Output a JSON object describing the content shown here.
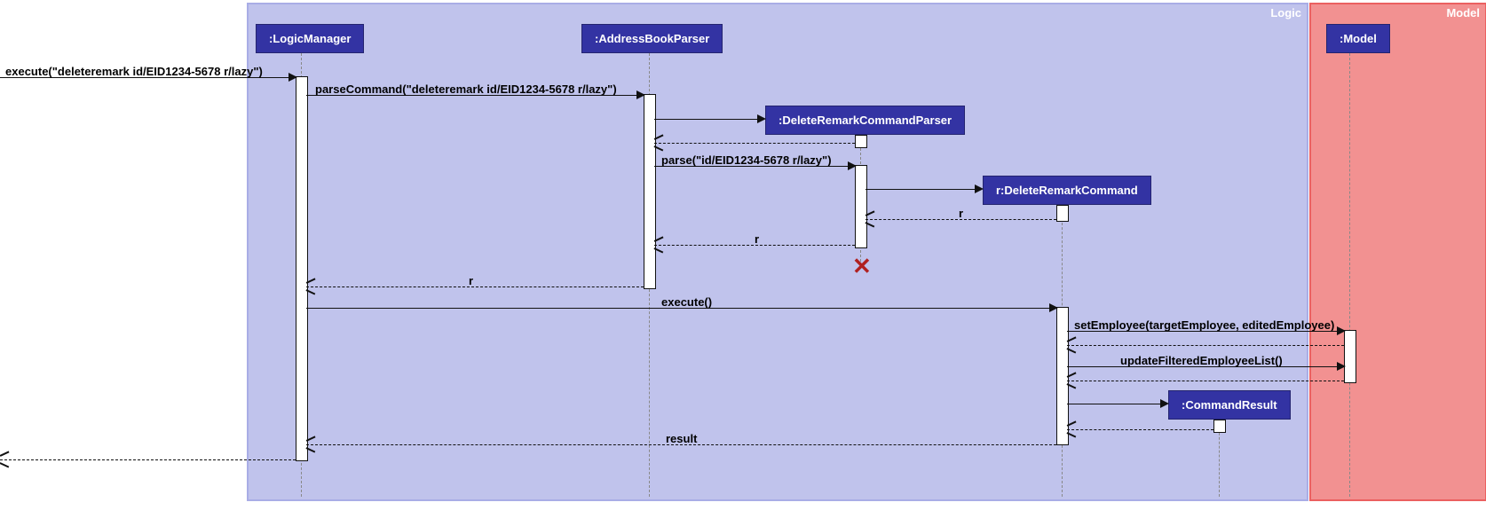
{
  "boxes": {
    "logic": "Logic",
    "model": "Model"
  },
  "lifelines": {
    "logicManager": ":LogicManager",
    "addressBookParser": ":AddressBookParser",
    "deleteRemarkCommandParser": ":DeleteRemarkCommandParser",
    "deleteRemarkCommand": "r:DeleteRemarkCommand",
    "commandResult": ":CommandResult",
    "model": ":Model"
  },
  "messages": {
    "execute1": "execute(\"deleteremark id/EID1234-5678 r/lazy\")",
    "parseCommand": "parseCommand(\"deleteremark id/EID1234-5678 r/lazy\")",
    "parse": "parse(\"id/EID1234-5678 r/lazy\")",
    "r1": "r",
    "r2": "r",
    "r3": "r",
    "execute2": "execute()",
    "setEmployee": "setEmployee(targetEmployee, editedEmployee)",
    "updateFiltered": "updateFilteredEmployeeList()",
    "result": "result"
  },
  "chart_data": {
    "type": "sequence_diagram",
    "boxes": [
      {
        "name": "Logic",
        "color": "#c0c3ec",
        "participants": [
          "LogicManager",
          "AddressBookParser",
          "DeleteRemarkCommandParser",
          "r:DeleteRemarkCommand",
          "CommandResult"
        ]
      },
      {
        "name": "Model",
        "color": "#f29191",
        "participants": [
          "Model"
        ]
      }
    ],
    "participants": [
      "(external)",
      "LogicManager",
      "AddressBookParser",
      "DeleteRemarkCommandParser",
      "r:DeleteRemarkCommand",
      "CommandResult",
      "Model"
    ],
    "messages": [
      {
        "from": "(external)",
        "to": "LogicManager",
        "label": "execute(\"deleteremark id/EID1234-5678 r/lazy\")",
        "type": "call"
      },
      {
        "from": "LogicManager",
        "to": "AddressBookParser",
        "label": "parseCommand(\"deleteremark id/EID1234-5678 r/lazy\")",
        "type": "call"
      },
      {
        "from": "AddressBookParser",
        "to": "DeleteRemarkCommandParser",
        "label": "",
        "type": "create"
      },
      {
        "from": "DeleteRemarkCommandParser",
        "to": "AddressBookParser",
        "label": "",
        "type": "return"
      },
      {
        "from": "AddressBookParser",
        "to": "DeleteRemarkCommandParser",
        "label": "parse(\"id/EID1234-5678 r/lazy\")",
        "type": "call"
      },
      {
        "from": "DeleteRemarkCommandParser",
        "to": "r:DeleteRemarkCommand",
        "label": "",
        "type": "create"
      },
      {
        "from": "r:DeleteRemarkCommand",
        "to": "DeleteRemarkCommandParser",
        "label": "r",
        "type": "return"
      },
      {
        "from": "DeleteRemarkCommandParser",
        "to": "AddressBookParser",
        "label": "r",
        "type": "return"
      },
      {
        "from": "DeleteRemarkCommandParser",
        "type": "destroy"
      },
      {
        "from": "AddressBookParser",
        "to": "LogicManager",
        "label": "r",
        "type": "return"
      },
      {
        "from": "LogicManager",
        "to": "r:DeleteRemarkCommand",
        "label": "execute()",
        "type": "call"
      },
      {
        "from": "r:DeleteRemarkCommand",
        "to": "Model",
        "label": "setEmployee(targetEmployee, editedEmployee)",
        "type": "call"
      },
      {
        "from": "Model",
        "to": "r:DeleteRemarkCommand",
        "label": "",
        "type": "return"
      },
      {
        "from": "r:DeleteRemarkCommand",
        "to": "Model",
        "label": "updateFilteredEmployeeList()",
        "type": "call"
      },
      {
        "from": "Model",
        "to": "r:DeleteRemarkCommand",
        "label": "",
        "type": "return"
      },
      {
        "from": "r:DeleteRemarkCommand",
        "to": "CommandResult",
        "label": "",
        "type": "create"
      },
      {
        "from": "CommandResult",
        "to": "r:DeleteRemarkCommand",
        "label": "",
        "type": "return"
      },
      {
        "from": "r:DeleteRemarkCommand",
        "to": "LogicManager",
        "label": "result",
        "type": "return"
      },
      {
        "from": "LogicManager",
        "to": "(external)",
        "label": "",
        "type": "return"
      }
    ]
  }
}
